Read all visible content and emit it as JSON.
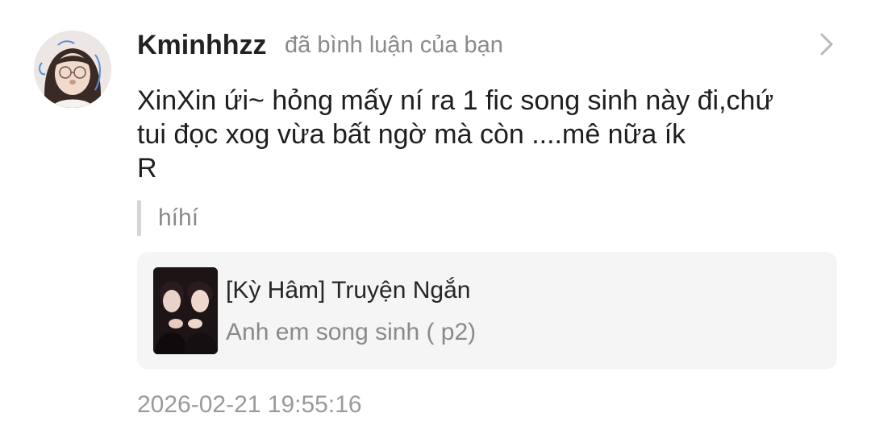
{
  "notification": {
    "username": "Kminhhzz",
    "action_text": "đã bình luận của bạn",
    "comment_text": "XinXin ứi~ hỏng mấy ní ra 1 fic song sinh này đi,chứ\ntui đọc xog vừa bất ngờ mà còn ....mê nữa ík\nR",
    "quoted_text": "híhí",
    "timestamp": "2026-02-21 19:55:16"
  },
  "story_card": {
    "title": "[Kỳ Hâm] Truyện Ngắn",
    "subtitle": "Anh em song sinh ( p2)"
  },
  "icons": {
    "chevron": "chevron-right-icon"
  },
  "colors": {
    "username": "#222222",
    "secondary_text": "#8a8a8a",
    "card_background": "#f5f5f5",
    "quote_bar": "#d6d6d6"
  }
}
